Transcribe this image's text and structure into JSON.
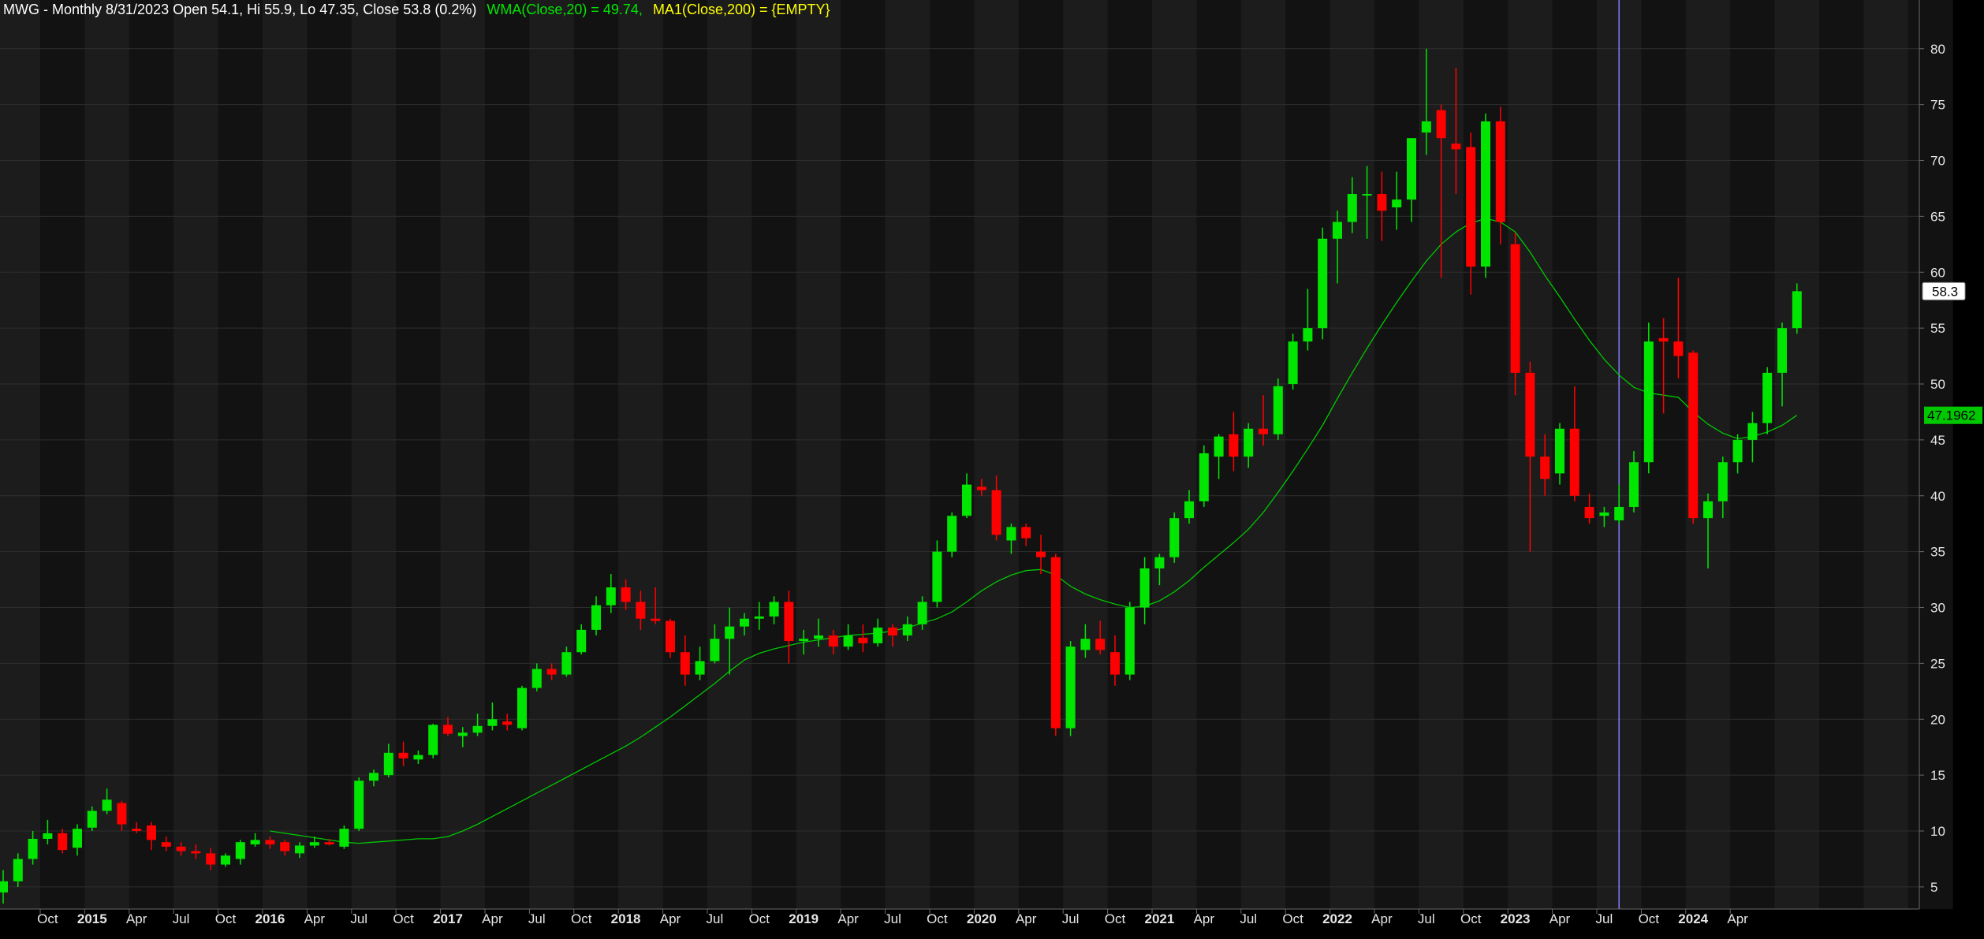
{
  "header": {
    "ticker": "MWG",
    "text_main": "MWG - Monthly 8/31/2023 Open 54.1, Hi 55.9, Lo 47.35, Close 53.8 (0.2%)",
    "text_wma": "WMA(Close,20) = 49.74,",
    "text_ma": "MA1(Close,200) = {EMPTY}"
  },
  "colors": {
    "background": "#000000",
    "band_light": "#1c1c1c",
    "band_dark": "#121212",
    "grid": "#2e2e2e",
    "up": "#00e600",
    "down": "#ff0000",
    "wma": "#00c800",
    "ma_label": "#ffff00",
    "header_text": "#ffffff",
    "cursor": "#8080ff"
  },
  "chart_data": {
    "type": "candlestick",
    "frequency": "monthly",
    "start_month": "2014-07",
    "y_ticks": [
      5,
      10,
      15,
      20,
      25,
      30,
      35,
      40,
      45,
      50,
      55,
      60,
      65,
      70,
      75,
      80
    ],
    "ylim": [
      2,
      83
    ],
    "x_labels": [
      {
        "month": "2014-10",
        "label": "Oct",
        "year": false
      },
      {
        "month": "2015-01",
        "label": "2015",
        "year": true
      },
      {
        "month": "2015-04",
        "label": "Apr",
        "year": false
      },
      {
        "month": "2015-07",
        "label": "Jul",
        "year": false
      },
      {
        "month": "2015-10",
        "label": "Oct",
        "year": false
      },
      {
        "month": "2016-01",
        "label": "2016",
        "year": true
      },
      {
        "month": "2016-04",
        "label": "Apr",
        "year": false
      },
      {
        "month": "2016-07",
        "label": "Jul",
        "year": false
      },
      {
        "month": "2016-10",
        "label": "Oct",
        "year": false
      },
      {
        "month": "2017-01",
        "label": "2017",
        "year": true
      },
      {
        "month": "2017-04",
        "label": "Apr",
        "year": false
      },
      {
        "month": "2017-07",
        "label": "Jul",
        "year": false
      },
      {
        "month": "2017-10",
        "label": "Oct",
        "year": false
      },
      {
        "month": "2018-01",
        "label": "2018",
        "year": true
      },
      {
        "month": "2018-04",
        "label": "Apr",
        "year": false
      },
      {
        "month": "2018-07",
        "label": "Jul",
        "year": false
      },
      {
        "month": "2018-10",
        "label": "Oct",
        "year": false
      },
      {
        "month": "2019-01",
        "label": "2019",
        "year": true
      },
      {
        "month": "2019-04",
        "label": "Apr",
        "year": false
      },
      {
        "month": "2019-07",
        "label": "Jul",
        "year": false
      },
      {
        "month": "2019-10",
        "label": "Oct",
        "year": false
      },
      {
        "month": "2020-01",
        "label": "2020",
        "year": true
      },
      {
        "month": "2020-04",
        "label": "Apr",
        "year": false
      },
      {
        "month": "2020-07",
        "label": "Jul",
        "year": false
      },
      {
        "month": "2020-10",
        "label": "Oct",
        "year": false
      },
      {
        "month": "2021-01",
        "label": "2021",
        "year": true
      },
      {
        "month": "2021-04",
        "label": "Apr",
        "year": false
      },
      {
        "month": "2021-07",
        "label": "Jul",
        "year": false
      },
      {
        "month": "2021-10",
        "label": "Oct",
        "year": false
      },
      {
        "month": "2022-01",
        "label": "2022",
        "year": true
      },
      {
        "month": "2022-04",
        "label": "Apr",
        "year": false
      },
      {
        "month": "2022-07",
        "label": "Jul",
        "year": false
      },
      {
        "month": "2022-10",
        "label": "Oct",
        "year": false
      },
      {
        "month": "2023-01",
        "label": "2023",
        "year": true
      },
      {
        "month": "2023-04",
        "label": "Apr",
        "year": false
      },
      {
        "month": "2023-07",
        "label": "Jul",
        "year": false
      },
      {
        "month": "2023-10",
        "label": "Oct",
        "year": false
      },
      {
        "month": "2024-01",
        "label": "2024",
        "year": true
      },
      {
        "month": "2024-04",
        "label": "Apr",
        "year": false
      }
    ],
    "cursor_month": "2023-08",
    "last_price_label": "58.3",
    "wma_value_label": "47.1962",
    "ohlc": [
      [
        4.5,
        6.5,
        3.5,
        5.5
      ],
      [
        5.5,
        8.0,
        5.0,
        7.5
      ],
      [
        7.5,
        10.0,
        7.0,
        9.3
      ],
      [
        9.3,
        11.0,
        8.8,
        9.8
      ],
      [
        9.8,
        10.2,
        8.0,
        8.3
      ],
      [
        8.5,
        10.6,
        7.8,
        10.2
      ],
      [
        10.3,
        12.2,
        10.0,
        11.8
      ],
      [
        11.8,
        13.8,
        11.5,
        12.8
      ],
      [
        12.5,
        12.7,
        10.0,
        10.6
      ],
      [
        10.2,
        10.8,
        9.8,
        10.0
      ],
      [
        10.5,
        10.8,
        8.3,
        9.2
      ],
      [
        9.0,
        9.5,
        8.2,
        8.6
      ],
      [
        8.6,
        9.0,
        7.8,
        8.2
      ],
      [
        8.2,
        8.8,
        7.5,
        8.0
      ],
      [
        8.0,
        8.5,
        6.5,
        7.0
      ],
      [
        7.0,
        8.0,
        6.8,
        7.8
      ],
      [
        7.5,
        9.2,
        7.0,
        9.0
      ],
      [
        8.8,
        9.8,
        8.6,
        9.2
      ],
      [
        9.2,
        9.5,
        8.4,
        8.8
      ],
      [
        9.0,
        9.2,
        7.8,
        8.2
      ],
      [
        8.0,
        9.0,
        7.6,
        8.7
      ],
      [
        8.7,
        9.5,
        8.5,
        9.0
      ],
      [
        9.0,
        9.3,
        8.7,
        8.8
      ],
      [
        8.6,
        10.5,
        8.4,
        10.2
      ],
      [
        10.2,
        14.8,
        10.0,
        14.5
      ],
      [
        14.5,
        15.5,
        14.0,
        15.2
      ],
      [
        15.0,
        17.8,
        14.8,
        17.0
      ],
      [
        17.0,
        18.0,
        15.8,
        16.5
      ],
      [
        16.4,
        17.2,
        16.0,
        16.8
      ],
      [
        16.8,
        19.6,
        16.5,
        19.5
      ],
      [
        19.5,
        20.2,
        18.5,
        18.7
      ],
      [
        18.5,
        19.3,
        17.5,
        18.8
      ],
      [
        18.8,
        20.5,
        18.5,
        19.4
      ],
      [
        19.4,
        21.5,
        19.0,
        20.0
      ],
      [
        19.8,
        20.5,
        19.0,
        19.5
      ],
      [
        19.2,
        23.0,
        19.0,
        22.8
      ],
      [
        22.8,
        25.0,
        22.5,
        24.5
      ],
      [
        24.5,
        25.0,
        23.5,
        24.0
      ],
      [
        24.0,
        26.5,
        23.8,
        26.0
      ],
      [
        26.0,
        28.5,
        25.8,
        28.0
      ],
      [
        28.0,
        31.0,
        27.5,
        30.2
      ],
      [
        30.2,
        33.0,
        29.5,
        31.8
      ],
      [
        31.8,
        32.5,
        29.8,
        30.5
      ],
      [
        30.5,
        31.5,
        28.0,
        29.0
      ],
      [
        29.0,
        31.8,
        28.5,
        28.8
      ],
      [
        28.8,
        29.0,
        25.5,
        26.0
      ],
      [
        26.0,
        27.5,
        23.0,
        24.0
      ],
      [
        24.0,
        26.5,
        23.5,
        25.2
      ],
      [
        25.2,
        28.5,
        25.0,
        27.2
      ],
      [
        27.2,
        30.0,
        24.0,
        28.3
      ],
      [
        28.3,
        29.5,
        27.5,
        29.0
      ],
      [
        29.0,
        30.5,
        28.0,
        29.2
      ],
      [
        29.2,
        31.0,
        28.5,
        30.5
      ],
      [
        30.5,
        31.5,
        25.0,
        27.0
      ],
      [
        27.0,
        28.0,
        25.8,
        27.2
      ],
      [
        27.2,
        29.0,
        26.5,
        27.5
      ],
      [
        27.5,
        28.0,
        25.8,
        26.5
      ],
      [
        26.5,
        28.5,
        26.2,
        27.5
      ],
      [
        27.3,
        28.5,
        26.0,
        26.8
      ],
      [
        26.8,
        29.0,
        26.5,
        28.2
      ],
      [
        28.2,
        28.5,
        26.5,
        27.5
      ],
      [
        27.5,
        29.2,
        27.0,
        28.5
      ],
      [
        28.5,
        31.0,
        28.0,
        30.5
      ],
      [
        30.5,
        36.0,
        30.0,
        35.0
      ],
      [
        35.0,
        38.5,
        34.5,
        38.2
      ],
      [
        38.2,
        42.0,
        38.0,
        41.0
      ],
      [
        40.8,
        41.5,
        40.0,
        40.5
      ],
      [
        40.5,
        41.8,
        36.0,
        36.5
      ],
      [
        36.0,
        37.5,
        34.8,
        37.2
      ],
      [
        37.2,
        37.5,
        35.5,
        36.2
      ],
      [
        35.0,
        36.5,
        33.0,
        34.5
      ],
      [
        34.5,
        34.8,
        18.5,
        19.2
      ],
      [
        19.2,
        27.0,
        18.5,
        26.5
      ],
      [
        26.2,
        28.5,
        25.5,
        27.2
      ],
      [
        27.2,
        28.8,
        25.8,
        26.2
      ],
      [
        26.0,
        27.5,
        23.0,
        24.0
      ],
      [
        24.0,
        30.5,
        23.5,
        30.0
      ],
      [
        30.0,
        34.5,
        28.5,
        33.5
      ],
      [
        33.5,
        34.8,
        32.0,
        34.5
      ],
      [
        34.5,
        38.5,
        34.0,
        38.0
      ],
      [
        38.0,
        40.5,
        37.5,
        39.5
      ],
      [
        39.5,
        44.5,
        39.0,
        43.8
      ],
      [
        43.5,
        45.5,
        41.5,
        45.3
      ],
      [
        45.5,
        47.5,
        42.2,
        43.5
      ],
      [
        43.5,
        46.5,
        42.5,
        46.0
      ],
      [
        46.0,
        49.0,
        44.5,
        45.5
      ],
      [
        45.5,
        50.5,
        45.0,
        49.8
      ],
      [
        50.0,
        54.5,
        49.5,
        53.8
      ],
      [
        53.8,
        58.5,
        53.0,
        55.0
      ],
      [
        55.0,
        64.0,
        54.0,
        63.0
      ],
      [
        63.0,
        65.5,
        59.0,
        64.5
      ],
      [
        64.5,
        68.5,
        63.5,
        67.0
      ],
      [
        67.0,
        69.5,
        63.0,
        67.0
      ],
      [
        67.0,
        69.0,
        62.8,
        65.5
      ],
      [
        65.8,
        69.0,
        63.8,
        66.5
      ],
      [
        66.5,
        72.0,
        64.5,
        72.0
      ],
      [
        72.5,
        80.0,
        70.5,
        73.5
      ],
      [
        74.5,
        75.0,
        59.5,
        72.0
      ],
      [
        71.5,
        78.3,
        67.0,
        71.0
      ],
      [
        71.2,
        72.5,
        58.0,
        60.5
      ],
      [
        60.5,
        74.2,
        59.5,
        73.5
      ],
      [
        73.5,
        74.8,
        62.5,
        64.5
      ],
      [
        62.5,
        63.5,
        49.0,
        51.0
      ],
      [
        51.0,
        52.0,
        35.0,
        43.5
      ],
      [
        43.5,
        45.5,
        40.0,
        41.5
      ],
      [
        42.0,
        46.5,
        41.0,
        46.0
      ],
      [
        46.0,
        49.8,
        39.5,
        40.0
      ],
      [
        39.0,
        40.2,
        37.5,
        38.0
      ],
      [
        38.2,
        39.0,
        37.2,
        38.5
      ],
      [
        37.8,
        41.0,
        37.5,
        39.0
      ],
      [
        39.0,
        44.0,
        38.5,
        43.0
      ],
      [
        43.0,
        55.5,
        42.0,
        53.8
      ],
      [
        54.1,
        55.9,
        47.35,
        53.8
      ],
      [
        53.8,
        59.5,
        50.5,
        52.5
      ],
      [
        52.8,
        53.0,
        37.5,
        38.0
      ],
      [
        38.0,
        40.2,
        33.5,
        39.5
      ],
      [
        39.5,
        43.5,
        38.0,
        43.0
      ],
      [
        43.0,
        45.5,
        42.0,
        45.0
      ],
      [
        45.0,
        47.5,
        43.0,
        46.5
      ],
      [
        46.5,
        51.5,
        45.5,
        51.0
      ],
      [
        51.0,
        55.5,
        48.0,
        55.0
      ],
      [
        55.0,
        59.0,
        54.5,
        58.3
      ]
    ],
    "wma": [
      null,
      null,
      null,
      null,
      null,
      null,
      null,
      null,
      null,
      null,
      null,
      null,
      null,
      null,
      null,
      null,
      null,
      null,
      10.0,
      9.8,
      9.6,
      9.4,
      9.2,
      9.0,
      8.9,
      9.0,
      9.1,
      9.2,
      9.3,
      9.3,
      9.5,
      10.0,
      10.6,
      11.3,
      12.0,
      12.7,
      13.4,
      14.1,
      14.8,
      15.5,
      16.2,
      16.9,
      17.6,
      18.4,
      19.3,
      20.2,
      21.2,
      22.2,
      23.2,
      24.3,
      25.3,
      25.9,
      26.3,
      26.6,
      26.9,
      27.1,
      27.3,
      27.5,
      27.6,
      27.7,
      27.9,
      28.2,
      28.6,
      29.0,
      29.6,
      30.5,
      31.5,
      32.3,
      32.9,
      33.3,
      33.4,
      32.9,
      31.9,
      31.2,
      30.7,
      30.3,
      30.0,
      30.1,
      30.6,
      31.4,
      32.4,
      33.6,
      34.7,
      35.8,
      37.0,
      38.5,
      40.3,
      42.2,
      44.2,
      46.3,
      48.7,
      51.0,
      53.2,
      55.3,
      57.3,
      59.2,
      61.0,
      62.5,
      63.6,
      64.4,
      64.8,
      64.5,
      63.6,
      61.8,
      59.7,
      57.8,
      55.8,
      53.9,
      52.2,
      50.8,
      49.7,
      49.2,
      49.0,
      48.8,
      47.5,
      46.4,
      45.6,
      45.1,
      45.3,
      45.7,
      46.3,
      47.2
    ]
  }
}
